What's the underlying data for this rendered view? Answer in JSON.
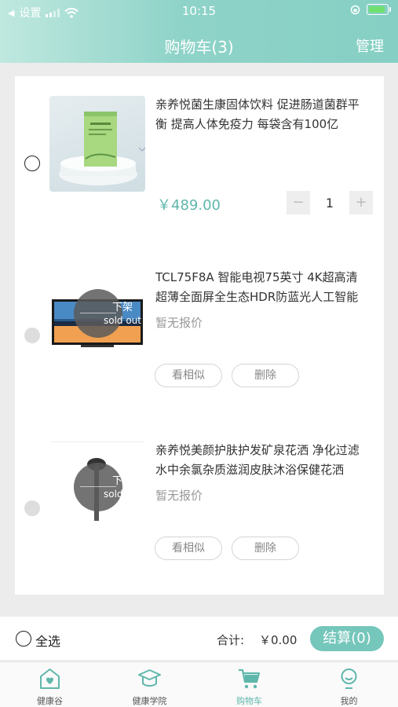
{
  "status_bar": {
    "carrier": "设置",
    "time": "10:15"
  },
  "nav": {
    "title": "购物车(3)",
    "manage": "管理"
  },
  "items": [
    {
      "title": "亲养悦菌生康固体饮料 促进肠道菌群平衡 提高人体免疫力 每袋含有100亿",
      "price": "￥489.00",
      "quantity": "1",
      "minus": "−",
      "plus": "+",
      "status": "active"
    },
    {
      "title": "TCL75F8A 智能电视75英寸 4K超高清超薄全面屏全生态HDR防蓝光人工智能",
      "price_text": "暂无报价",
      "sold_out_cn": "下架",
      "sold_out_en": "sold out",
      "similar": "看相似",
      "delete": "删除",
      "status": "off_shelf"
    },
    {
      "title": "亲养悦美颜护肤护发矿泉花洒 净化过滤水中余氯杂质滋润皮肤沐浴保健花洒",
      "price_text": "暂无报价",
      "sold_out_cn": "下架",
      "sold_out_en": "sold out",
      "similar": "看相似",
      "delete": "删除",
      "status": "off_shelf"
    }
  ],
  "checkout": {
    "select_all": "全选",
    "total_label": "合计:",
    "total_value": "￥0.00",
    "button": "结算(0)"
  },
  "tabs": [
    {
      "label": "健康谷",
      "icon": "home-heart-icon"
    },
    {
      "label": "健康学院",
      "icon": "graduation-cap-icon"
    },
    {
      "label": "购物车",
      "icon": "cart-icon",
      "active": true
    },
    {
      "label": "我的",
      "icon": "user-icon"
    }
  ],
  "colors": {
    "accent": "#75c6bb",
    "price": "#5fb7ab",
    "header_start": "#bfe8df",
    "header_end": "#86cfc4"
  }
}
